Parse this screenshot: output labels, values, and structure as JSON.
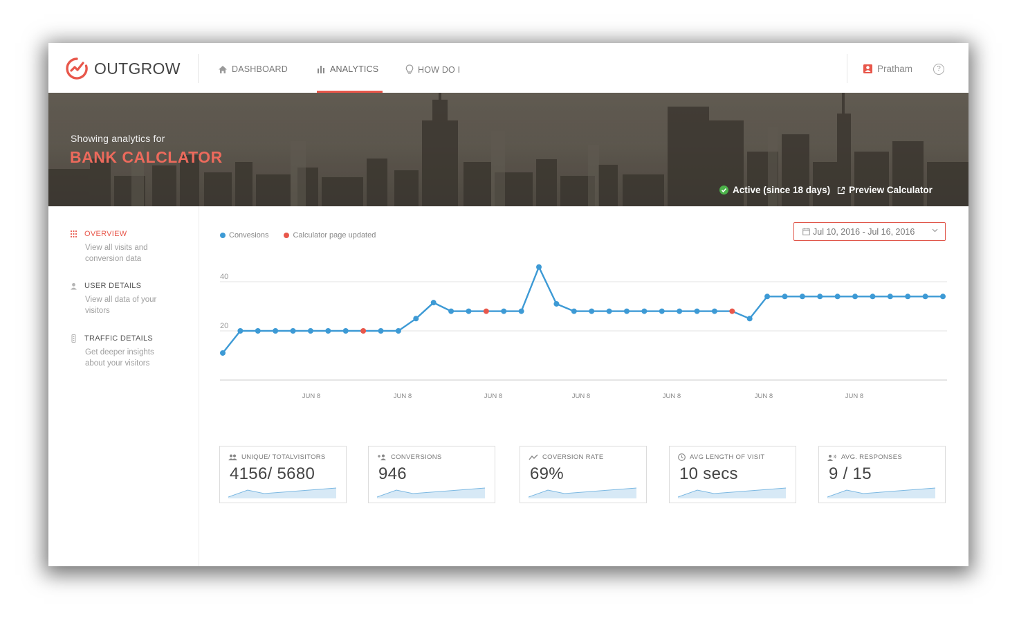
{
  "app": {
    "name": "OUTGROW"
  },
  "nav": {
    "items": [
      {
        "label": "DASHBOARD",
        "icon": "home-icon"
      },
      {
        "label": "ANALYTICS",
        "icon": "bar-chart-icon",
        "active": true
      },
      {
        "label": "HOW DO I",
        "icon": "lightbulb-icon"
      }
    ],
    "user": "Pratham",
    "help_icon": "question-circle-icon"
  },
  "hero": {
    "subtitle": "Showing analytics for",
    "title": "BANK CALCLATOR",
    "status": "Active (since 18 days)",
    "preview_label": "Preview Calculator"
  },
  "sidebar": {
    "items": [
      {
        "label": "OVERVIEW",
        "description": "View all visits and conversion data",
        "icon": "grid-dots-icon",
        "active": true
      },
      {
        "label": "USER DETAILS",
        "description": "View all data of your visitors",
        "icon": "user-icon"
      },
      {
        "label": "TRAFFIC DETAILS",
        "description": "Get deeper insights about your visitors",
        "icon": "traffic-light-icon"
      }
    ]
  },
  "legend": {
    "conversions": "Convesions",
    "updated": "Calculator page updated"
  },
  "date_range": "Jul 10, 2016 - Jul 16, 2016",
  "colors": {
    "accent": "#e8574b",
    "series": "#3d9ad5",
    "marker_updated": "#e8574b",
    "status": "#4cb24a"
  },
  "chart_data": {
    "type": "line",
    "y_ticks": [
      "20",
      "40"
    ],
    "ylim": [
      0,
      50
    ],
    "x_tick_labels": [
      "JUN 8",
      "JUN 8",
      "JUN 8",
      "JUN 8",
      "JUN 8",
      "JUN 8",
      "JUN 8"
    ],
    "series": [
      {
        "name": "Convesions",
        "values": [
          11,
          20,
          20,
          20,
          20,
          20,
          20,
          20,
          20,
          20,
          20,
          25,
          31.5,
          28,
          28,
          28,
          28,
          28,
          46,
          31,
          28,
          28,
          28,
          28,
          28,
          28,
          28,
          28,
          28,
          28,
          25,
          34,
          34,
          34,
          34,
          34,
          34,
          34,
          34,
          34,
          34,
          34
        ]
      }
    ],
    "updated_points": [
      8,
      15,
      29
    ]
  },
  "stats": [
    {
      "label": "UNIQUE/ TOTALVISITORS",
      "value": "4156/ 5680",
      "icon": "users-icon"
    },
    {
      "label": "CONVERSIONS",
      "value": "946",
      "icon": "user-plus-icon"
    },
    {
      "label": "COVERSION RATE",
      "value": "69%",
      "icon": "trend-line-icon"
    },
    {
      "label": "AVG LENGTH OF VISIT",
      "value": "10 secs",
      "icon": "clock-icon"
    },
    {
      "label": "AVG. RESPONSES",
      "value": "9 / 15",
      "icon": "megaphone-icon"
    }
  ]
}
